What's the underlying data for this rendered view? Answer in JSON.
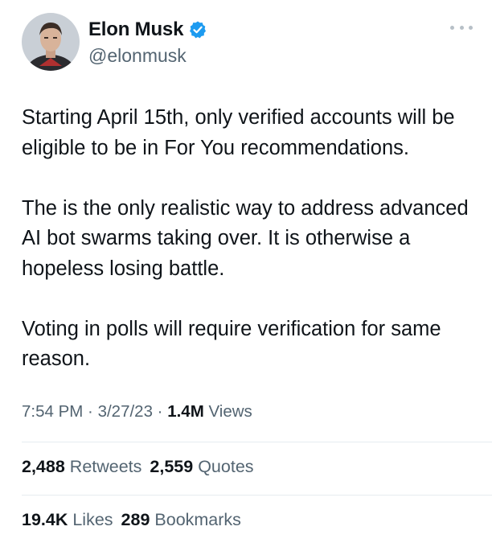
{
  "author": {
    "display_name": "Elon Musk",
    "handle": "@elonmusk",
    "verified_icon": "verified-badge-icon",
    "verified_color": "#1d9bf0"
  },
  "more_icon": "more-horizontal-icon",
  "tweet": {
    "paragraphs": [
      "Starting April 15th, only verified accounts will be eligible to be in For You recommendations.",
      "The is the only realistic way to address advanced AI bot swarms taking over. It is otherwise a hopeless losing battle.",
      "Voting in polls will require verification for same reason."
    ]
  },
  "meta": {
    "time": "7:54 PM",
    "sep1": " · ",
    "date": "3/27/23",
    "sep2": " · ",
    "views_count": "1.4M",
    "views_label": " Views"
  },
  "engagement": {
    "retweets_count": "2,488",
    "retweets_label": " Retweets",
    "quotes_count": "2,559",
    "quotes_label": " Quotes",
    "likes_count": "19.4K",
    "likes_label": " Likes",
    "bookmarks_count": "289",
    "bookmarks_label": " Bookmarks"
  },
  "colors": {
    "text_primary": "#0f1419",
    "text_secondary": "#536471",
    "divider": "#e6ecf0"
  }
}
